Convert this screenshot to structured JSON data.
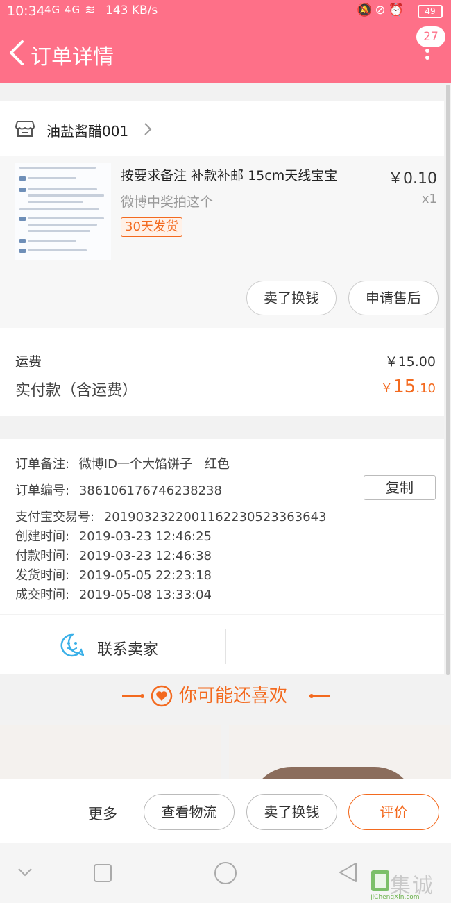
{
  "status_bar": {
    "time": "10:34",
    "signal": "4G 4G",
    "speed": "143 KB/s",
    "battery": "49"
  },
  "header": {
    "title": "订单详情",
    "badge_count": "27"
  },
  "shop": {
    "name": "油盐酱醋001"
  },
  "item": {
    "title": "按要求备注 补款补邮 15cm天线宝宝",
    "subtitle": "微博中奖拍这个",
    "tag": "30天发货",
    "price": "￥0.10",
    "qty": "x1",
    "buttons": [
      "卖了换钱",
      "申请售后"
    ]
  },
  "fees": {
    "shipping_label": "运费",
    "shipping_value": "￥15.00",
    "paid_label": "实付款（含运费）",
    "paid_currency": "￥",
    "paid_int": "15",
    "paid_dec": ".10"
  },
  "order_info": {
    "note_label": "订单备注:",
    "note_value": "微博ID一个大馅饼子　红色",
    "number_label": "订单编号:",
    "number_value": "386106176746238238",
    "copy_button": "复制",
    "alipay_label": "支付宝交易号:",
    "alipay_value": "2019032322001162230523363643",
    "created_label": "创建时间:",
    "created_value": "2019-03-23 12:46:25",
    "paid_label": "付款时间:",
    "paid_value": "2019-03-23 12:46:38",
    "shipped_label": "发货时间:",
    "shipped_value": "2019-05-05 22:23:18",
    "closed_label": "成交时间:",
    "closed_value": "2019-05-08 13:33:04"
  },
  "contact": {
    "label": "联系卖家"
  },
  "recommend": {
    "title": "你可能还喜欢"
  },
  "bottom_bar": {
    "more": "更多",
    "logistics": "查看物流",
    "sell": "卖了换钱",
    "review": "评价"
  },
  "watermark": {
    "text": "集诚信",
    "sub": "JiChengXin.com"
  },
  "colors": {
    "header": "#fe7088",
    "accent": "#f36a1f"
  }
}
